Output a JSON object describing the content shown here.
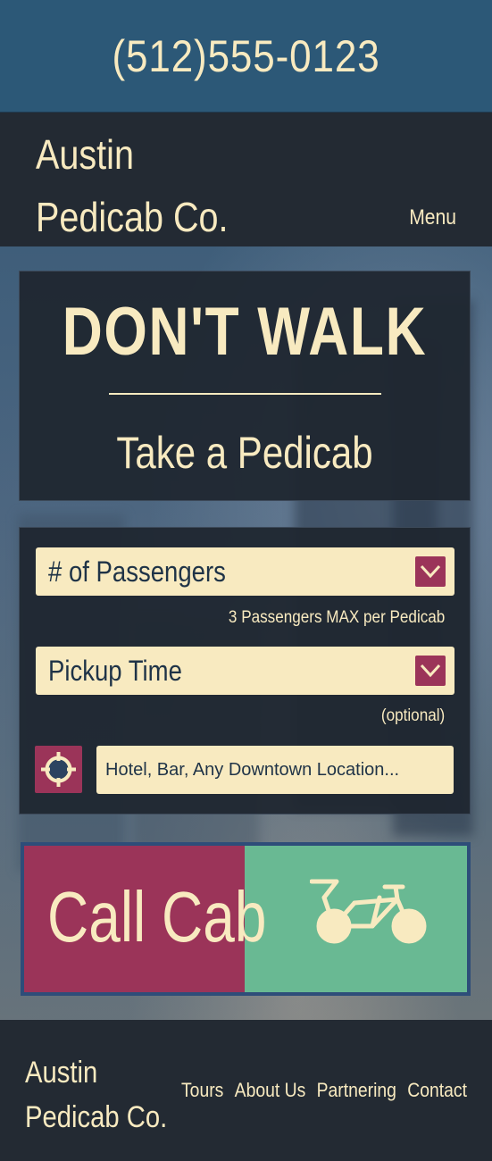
{
  "top_bar": {
    "phone": "(512)555-0123"
  },
  "header": {
    "brand_line1": "Austin",
    "brand_line2": "Pedicab Co.",
    "menu_label": "Menu"
  },
  "hero": {
    "headline": "DON'T WALK",
    "subheadline": "Take a Pedicab"
  },
  "form": {
    "passengers_label": "# of Passengers",
    "passengers_hint": "3 Passengers MAX per Pedicab",
    "pickup_label": "Pickup Time",
    "pickup_hint": "(optional)",
    "location_placeholder": "Hotel, Bar, Any Downtown Location...",
    "location_value": ""
  },
  "call_button": {
    "label": "Call Cab"
  },
  "footer": {
    "brand_line1": "Austin",
    "brand_line2": "Pedicab Co.",
    "nav": [
      "Tours",
      "About Us",
      "Partnering",
      "Contact"
    ]
  },
  "icons": {
    "select_toggle": "chevron-down-icon",
    "locate": "crosshair-icon",
    "vehicle": "bicycle-icon"
  },
  "colors": {
    "cream": "#f8eac0",
    "navy": "#232a33",
    "blue": "#2c5877",
    "maroon": "#9b3459",
    "green": "#69b993"
  }
}
